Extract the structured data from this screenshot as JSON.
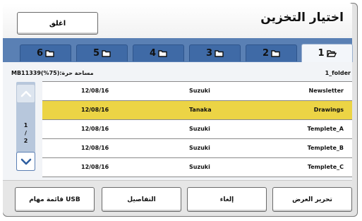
{
  "header": {
    "title": "اختيار التخزين",
    "close_label": "اغلق"
  },
  "tabs": [
    {
      "label": "1",
      "icon": "open-folder-icon",
      "active": true
    },
    {
      "label": "2",
      "icon": "folder-icon",
      "active": false
    },
    {
      "label": "3",
      "icon": "folder-icon",
      "active": false
    },
    {
      "label": "4",
      "icon": "folder-icon",
      "active": false
    },
    {
      "label": "5",
      "icon": "folder-icon",
      "active": false
    },
    {
      "label": "6",
      "icon": "folder-icon",
      "active": false
    }
  ],
  "info": {
    "free_space": "مساحة حرة:MB11339(%75)",
    "folder_name": "1_folder"
  },
  "pagination": {
    "current": "1",
    "separator": "/",
    "total": "2"
  },
  "files": [
    {
      "name": "Newsletter",
      "owner": "Suzuki",
      "date": "12/08/16",
      "selected": false
    },
    {
      "name": "Drawings",
      "owner": "Tanaka",
      "date": "12/08/16",
      "selected": true
    },
    {
      "name": "Templete_A",
      "owner": "Suzuki",
      "date": "12/08/16",
      "selected": false
    },
    {
      "name": "Templete_B",
      "owner": "Suzuki",
      "date": "12/08/16",
      "selected": false
    },
    {
      "name": "Templete_C",
      "owner": "Suzuki",
      "date": "12/08/16",
      "selected": false
    }
  ],
  "buttons": {
    "edit_view": "تحرير العرض",
    "cancel": "إلغاء",
    "details": "التفاصيل",
    "usb_jobs": "قائمة مهام USB"
  },
  "colors": {
    "tab_bar": "#5a80b4",
    "selected_row": "#ecd445",
    "scroll_arrow": "#2f5fa0"
  }
}
